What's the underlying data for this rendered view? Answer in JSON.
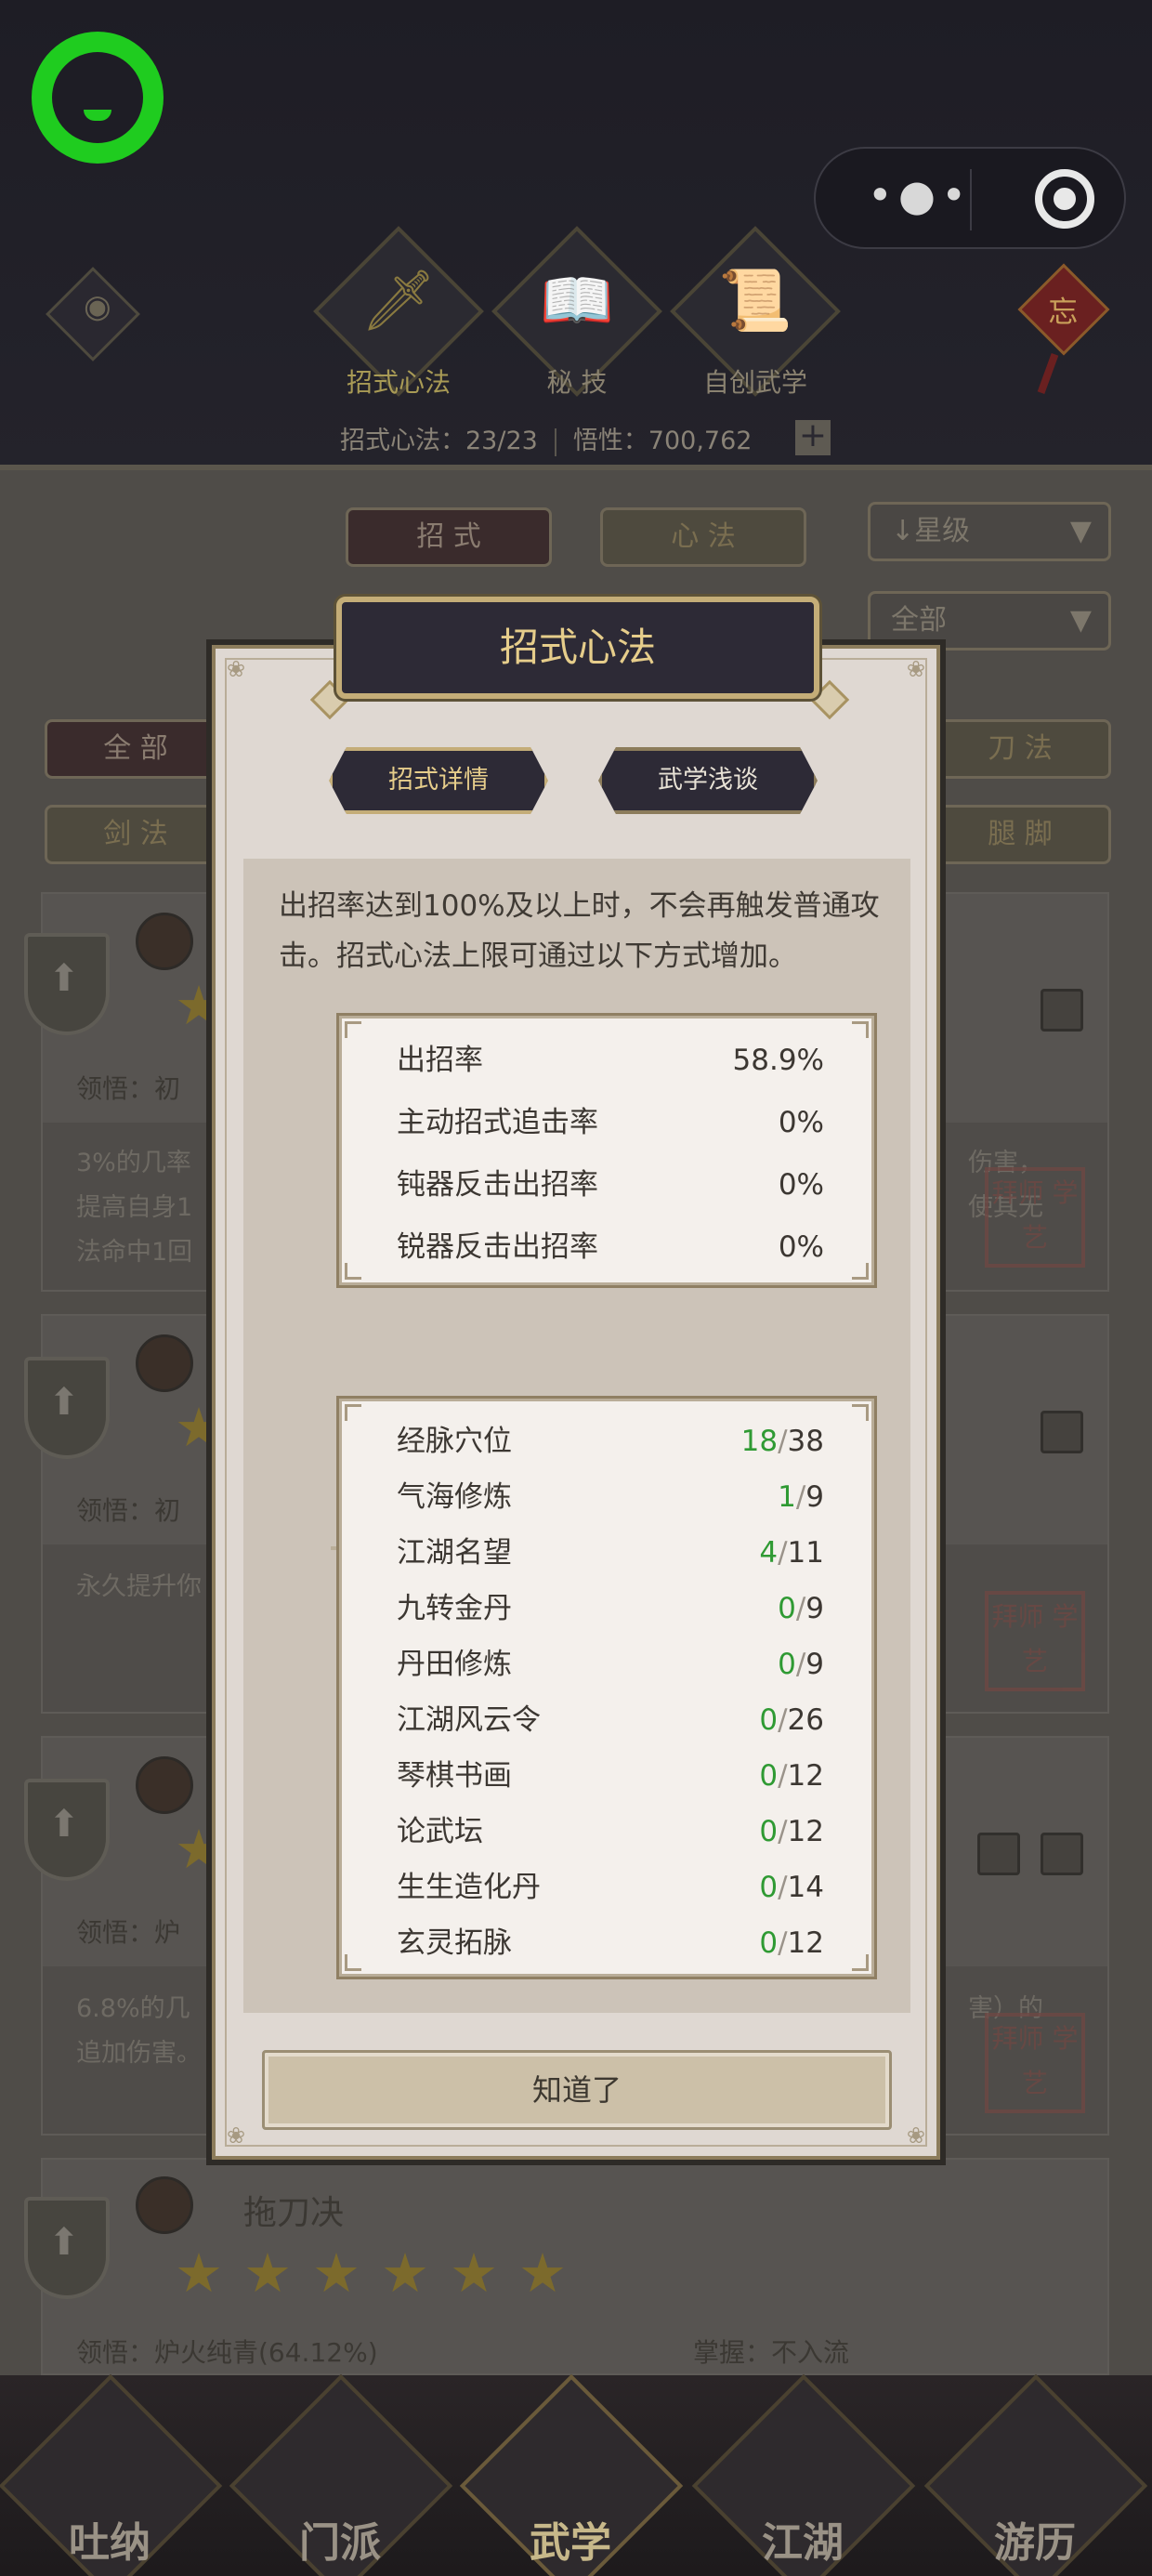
{
  "top_tabs": [
    {
      "label": "招式心法",
      "active": true
    },
    {
      "label": "秘 技",
      "active": false
    },
    {
      "label": "自创武学",
      "active": false
    }
  ],
  "stats": {
    "moves": "招式心法：23/23",
    "insight": "悟性：700,762",
    "plus": "+"
  },
  "filters": {
    "move_tab": "招 式",
    "heart_tab": "心 法",
    "sort": "星级",
    "scope": "全部",
    "type_all": "全 部",
    "type_sword": "剑 法",
    "type_blade": "刀 法",
    "type_leg": "腿 脚"
  },
  "cards": [
    {
      "insight_label": "领悟：初",
      "desc1": "3%的几率",
      "desc2": "提高自身1",
      "desc3": "法命中1回",
      "desc_r1": "伤害，",
      "desc_r2": "使其无"
    },
    {
      "insight_label": "领悟：初",
      "desc1": "永久提升你"
    },
    {
      "insight_label": "领悟：炉",
      "desc1": "6.8%的几",
      "desc2": "追加伤害。",
      "desc_r1": "害）的"
    },
    {
      "name": "拖刀决",
      "insight_label": "领悟：炉火纯青(64.12%)",
      "mastery": "掌握：不入流"
    }
  ],
  "stamp_text": "拜师\n学艺",
  "bottom_nav": [
    {
      "label": "吐纳",
      "active": false
    },
    {
      "label": "门派",
      "active": false
    },
    {
      "label": "武学",
      "active": true
    },
    {
      "label": "江湖",
      "active": false
    },
    {
      "label": "游历",
      "active": false
    }
  ],
  "modal": {
    "title": "招式心法",
    "tab_detail": "招式详情",
    "tab_talk": "武学浅谈",
    "info": "出招率达到100%及以上时，不会再触发普通攻击。招式心法上限可通过以下方式增加。",
    "rates": [
      {
        "label": "出招率",
        "value": "58.9%"
      },
      {
        "label": "主动招式追击率",
        "value": "0%"
      },
      {
        "label": "钝器反击出招率",
        "value": "0%"
      },
      {
        "label": "锐器反击出招率",
        "value": "0%"
      }
    ],
    "sources": [
      {
        "label": "经脉穴位",
        "got": "18",
        "total": "38"
      },
      {
        "label": "气海修炼",
        "got": "1",
        "total": "9"
      },
      {
        "label": "江湖名望",
        "got": "4",
        "total": "11"
      },
      {
        "label": "九转金丹",
        "got": "0",
        "total": "9"
      },
      {
        "label": "丹田修炼",
        "got": "0",
        "total": "9"
      },
      {
        "label": "江湖风云令",
        "got": "0",
        "total": "26"
      },
      {
        "label": "琴棋书画",
        "got": "0",
        "total": "12"
      },
      {
        "label": "论武坛",
        "got": "0",
        "total": "12"
      },
      {
        "label": "生生造化丹",
        "got": "0",
        "total": "14"
      },
      {
        "label": "玄灵拓脉",
        "got": "0",
        "total": "12"
      }
    ],
    "confirm": "知道了"
  },
  "colors": {
    "got": "#2f9a33",
    "gold": "#e6cd8b",
    "header_bg": "#2d2a36"
  }
}
